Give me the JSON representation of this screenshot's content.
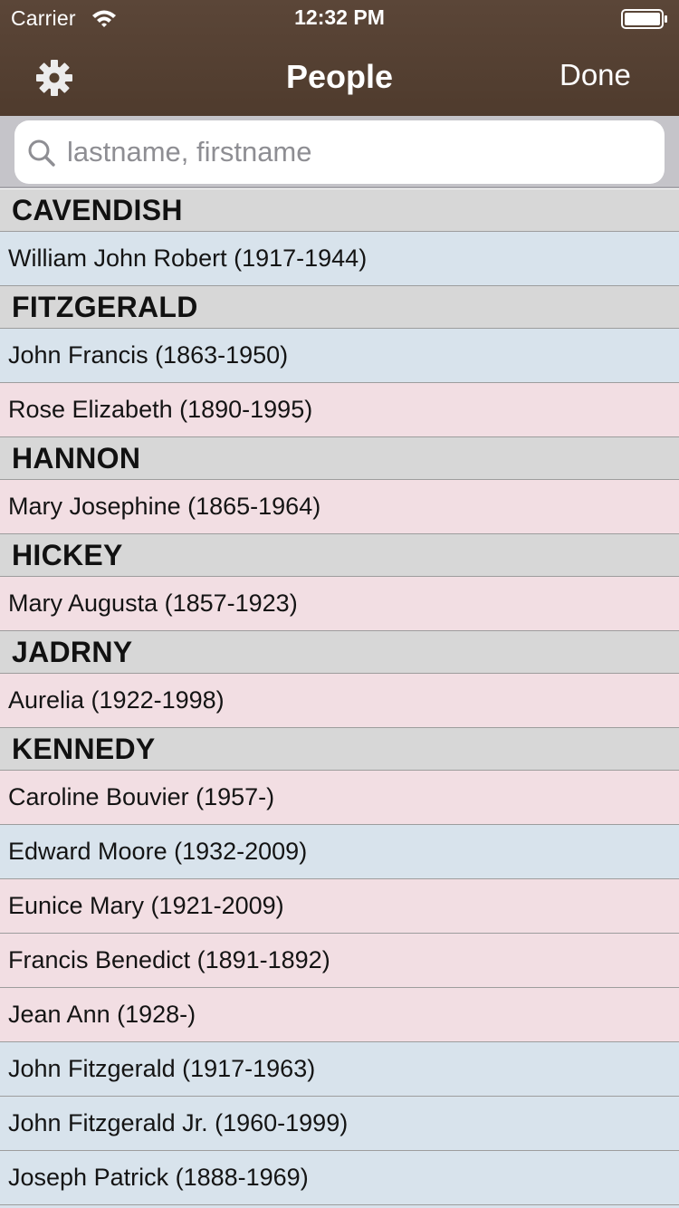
{
  "status_bar": {
    "carrier": "Carrier",
    "time": "12:32 PM"
  },
  "nav": {
    "title": "People",
    "done_label": "Done",
    "settings_icon": "gear-icon"
  },
  "search": {
    "placeholder": "lastname, firstname",
    "value": ""
  },
  "colors": {
    "nav_bg": "#5b4638",
    "male_row": "#d8e3ec",
    "female_row": "#f2dee3",
    "section_bg": "#d7d7d7"
  },
  "sections": [
    {
      "header": "CAVENDISH",
      "rows": [
        {
          "label": "William John Robert (1917-1944)",
          "gender": "male"
        }
      ]
    },
    {
      "header": "FITZGERALD",
      "rows": [
        {
          "label": "John Francis (1863-1950)",
          "gender": "male"
        },
        {
          "label": "Rose Elizabeth (1890-1995)",
          "gender": "female"
        }
      ]
    },
    {
      "header": "HANNON",
      "rows": [
        {
          "label": "Mary Josephine (1865-1964)",
          "gender": "female"
        }
      ]
    },
    {
      "header": "HICKEY",
      "rows": [
        {
          "label": "Mary Augusta (1857-1923)",
          "gender": "female"
        }
      ]
    },
    {
      "header": "JADRNY",
      "rows": [
        {
          "label": "Aurelia (1922-1998)",
          "gender": "female"
        }
      ]
    },
    {
      "header": "KENNEDY",
      "rows": [
        {
          "label": "Caroline Bouvier (1957-)",
          "gender": "female"
        },
        {
          "label": "Edward Moore (1932-2009)",
          "gender": "male"
        },
        {
          "label": "Eunice Mary (1921-2009)",
          "gender": "female"
        },
        {
          "label": "Francis Benedict (1891-1892)",
          "gender": "female"
        },
        {
          "label": "Jean Ann (1928-)",
          "gender": "female"
        },
        {
          "label": "John Fitzgerald (1917-1963)",
          "gender": "male"
        },
        {
          "label": "John Fitzgerald Jr. (1960-1999)",
          "gender": "male"
        },
        {
          "label": "Joseph Patrick (1888-1969)",
          "gender": "male"
        },
        {
          "label": "",
          "gender": "male"
        }
      ]
    }
  ]
}
